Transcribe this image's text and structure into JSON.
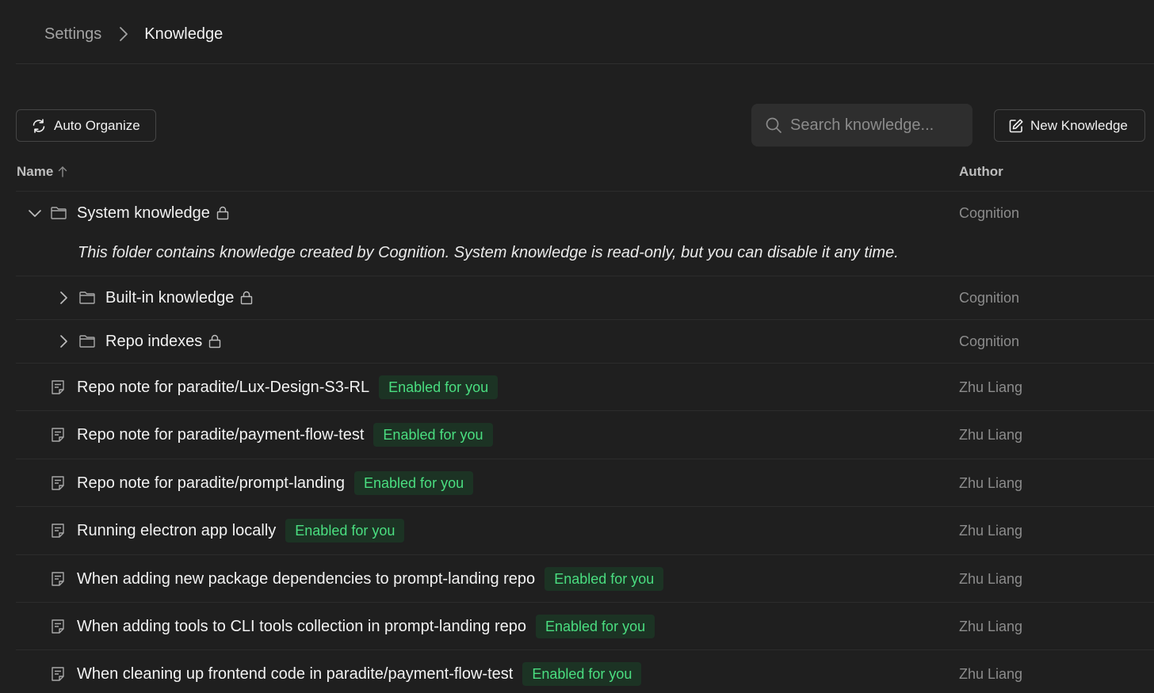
{
  "breadcrumb": {
    "parent": "Settings",
    "current": "Knowledge"
  },
  "toolbar": {
    "auto_organize_label": "Auto Organize",
    "search_placeholder": "Search knowledge...",
    "new_knowledge_label": "New Knowledge"
  },
  "table": {
    "columns": {
      "name": "Name",
      "author": "Author"
    },
    "sort": "ascending"
  },
  "folders": [
    {
      "name": "System knowledge",
      "author": "Cognition",
      "expanded": true,
      "locked": true,
      "description": "This folder contains knowledge created by Cognition. System knowledge is read-only, but you can disable it any time."
    },
    {
      "name": "Built-in knowledge",
      "author": "Cognition",
      "expanded": false,
      "locked": true
    },
    {
      "name": "Repo indexes",
      "author": "Cognition",
      "expanded": false,
      "locked": true
    }
  ],
  "notes": [
    {
      "title": "Repo note for paradite/Lux-Design-S3-RL",
      "badge": "Enabled for you",
      "author": "Zhu Liang"
    },
    {
      "title": "Repo note for paradite/payment-flow-test",
      "badge": "Enabled for you",
      "author": "Zhu Liang"
    },
    {
      "title": "Repo note for paradite/prompt-landing",
      "badge": "Enabled for you",
      "author": "Zhu Liang"
    },
    {
      "title": "Running electron app locally",
      "badge": "Enabled for you",
      "author": "Zhu Liang"
    },
    {
      "title": "When adding new package dependencies to prompt-landing repo",
      "badge": "Enabled for you",
      "author": "Zhu Liang"
    },
    {
      "title": "When adding tools to CLI tools collection in prompt-landing repo",
      "badge": "Enabled for you",
      "author": "Zhu Liang"
    },
    {
      "title": "When cleaning up frontend code in paradite/payment-flow-test",
      "badge": "Enabled for you",
      "author": "Zhu Liang"
    }
  ],
  "colors": {
    "background": "#1f1f1f",
    "badge_bg": "#1c3324",
    "badge_text": "#4ade80",
    "muted_text": "#8c8c8c"
  }
}
